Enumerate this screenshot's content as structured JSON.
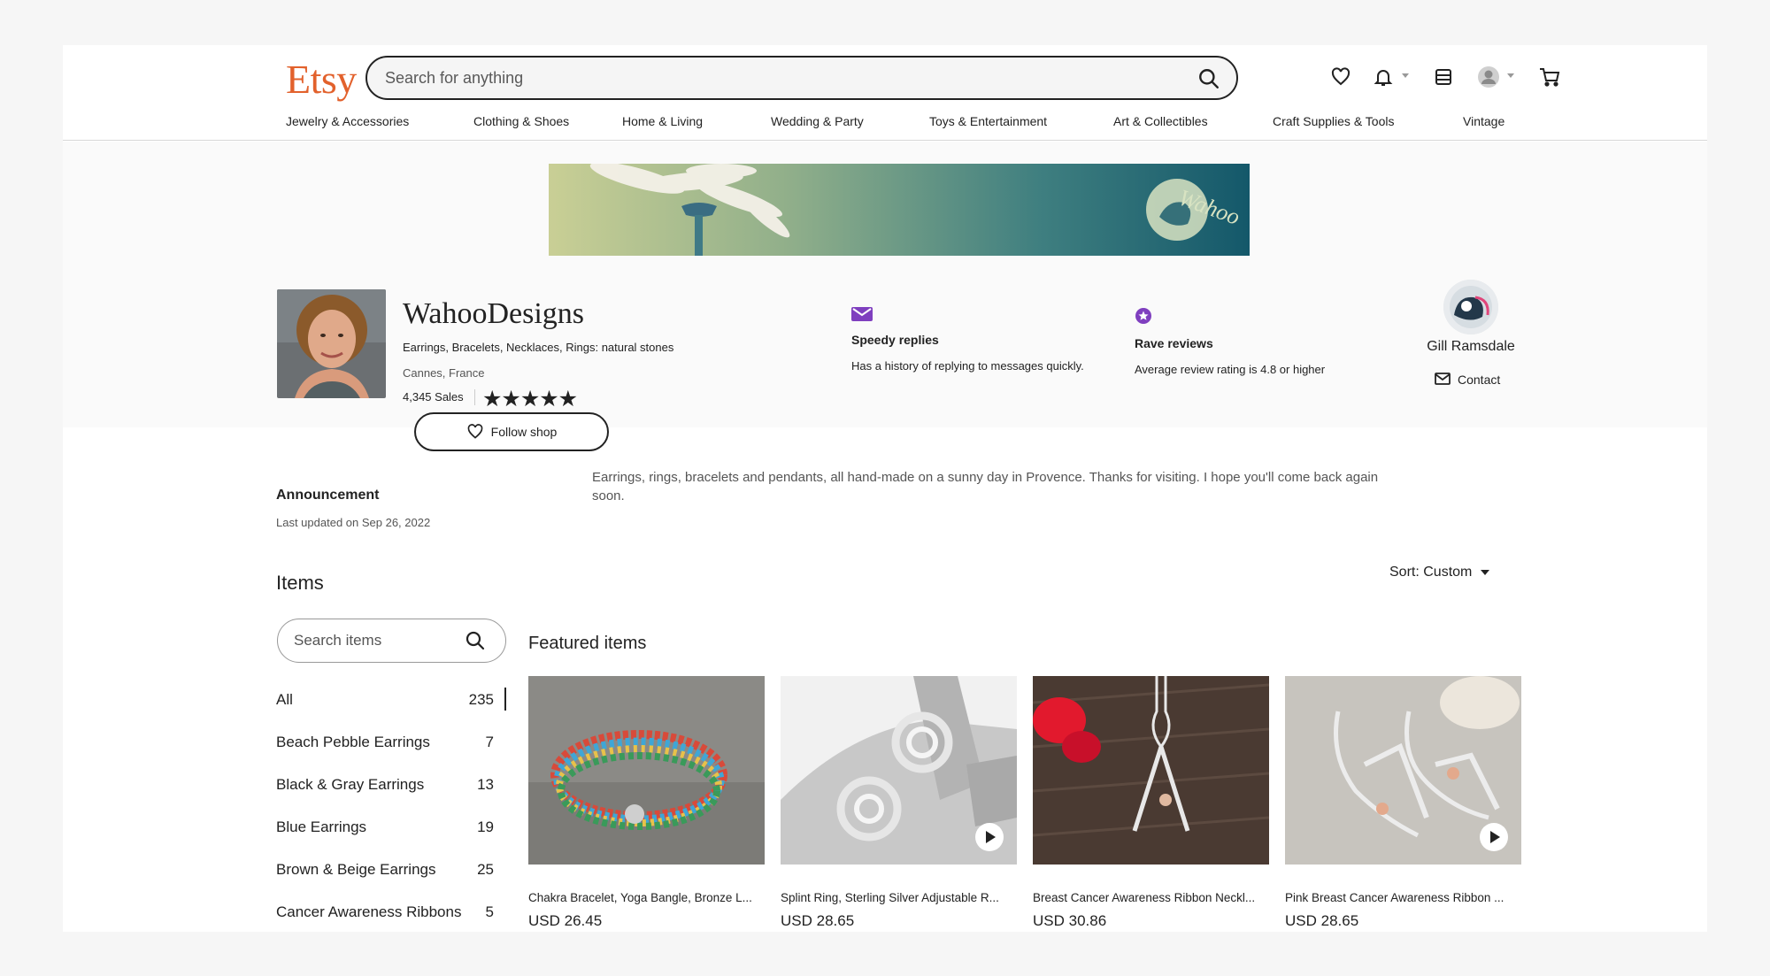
{
  "header": {
    "logo": "Etsy",
    "search_placeholder": "Search for anything",
    "nav": [
      "Jewelry & Accessories",
      "Clothing & Shoes",
      "Home & Living",
      "Wedding & Party",
      "Toys & Entertainment",
      "Art & Collectibles",
      "Craft Supplies & Tools",
      "Vintage"
    ]
  },
  "shop": {
    "name": "WahooDesigns",
    "tagline": "Earrings, Bracelets, Necklaces, Rings: natural stones",
    "location": "Cannes, France",
    "sales": "4,345 Sales",
    "rating_stars": 5,
    "stars_text": "★★★★★",
    "follow_label": "Follow shop",
    "badges": [
      {
        "icon": "envelope-icon",
        "title": "Speedy replies",
        "desc": "Has a history of replying to messages quickly."
      },
      {
        "icon": "star-badge-icon",
        "title": "Rave reviews",
        "desc": "Average review rating is 4.8 or higher"
      }
    ],
    "owner": {
      "name": "Gill Ramsdale",
      "contact_label": "Contact"
    }
  },
  "announcement": {
    "title": "Announcement",
    "updated": "Last updated on Sep 26, 2022",
    "text": "Earrings, rings, bracelets and pendants, all hand-made on a sunny day in Provence. Thanks for visiting. I hope you'll come back again soon."
  },
  "items": {
    "title": "Items",
    "sort_label": "Sort: Custom",
    "search_placeholder": "Search items",
    "categories": [
      {
        "name": "All",
        "count": "235"
      },
      {
        "name": "Beach Pebble Earrings",
        "count": "7"
      },
      {
        "name": "Black & Gray Earrings",
        "count": "13"
      },
      {
        "name": "Blue Earrings",
        "count": "19"
      },
      {
        "name": "Brown & Beige Earrings",
        "count": "25"
      },
      {
        "name": "Cancer Awareness Ribbons",
        "count": "5"
      }
    ],
    "featured_title": "Featured items",
    "featured": [
      {
        "title": "Chakra Bracelet, Yoga Bangle, Bronze L...",
        "price": "USD 26.45",
        "video": false
      },
      {
        "title": "Splint Ring, Sterling Silver Adjustable R...",
        "price": "USD 28.65",
        "video": true
      },
      {
        "title": "Breast Cancer Awareness Ribbon Neckl...",
        "price": "USD 30.86",
        "video": false
      },
      {
        "title": "Pink Breast Cancer Awareness Ribbon ...",
        "price": "USD 28.65",
        "video": true
      }
    ]
  },
  "colors": {
    "brand": "#e2612c",
    "badge": "#7f3fbf",
    "text": "#222222"
  }
}
